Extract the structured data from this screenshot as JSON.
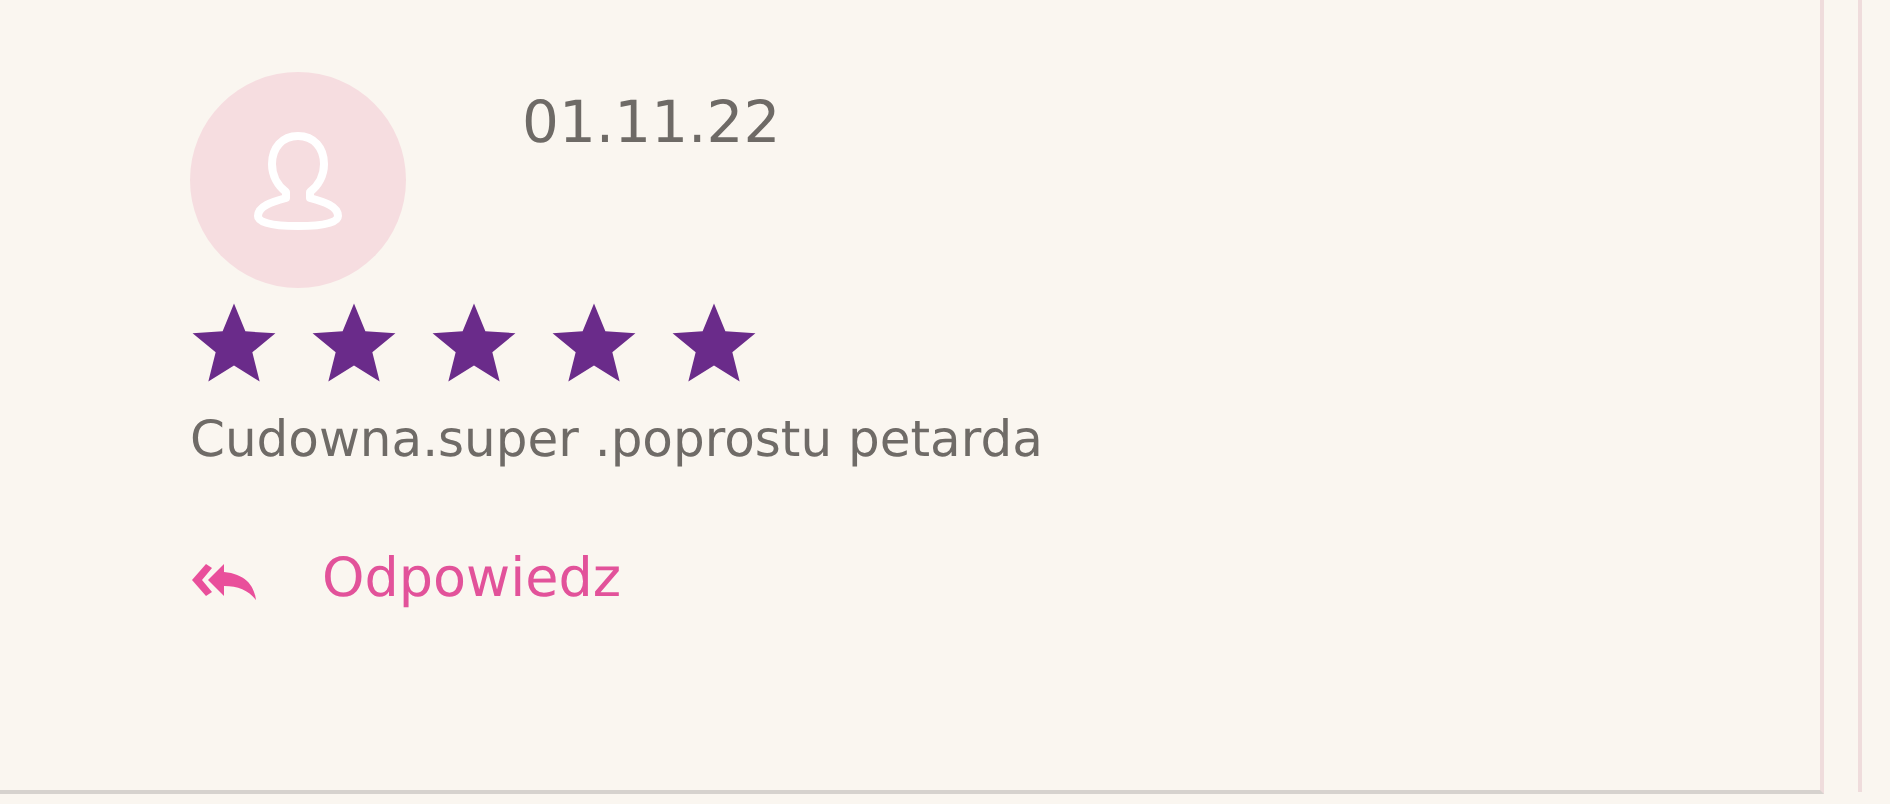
{
  "review": {
    "date": "01.11.22",
    "stars": 5,
    "text": "Cudowna.super .poprostu petarda",
    "reply_label": "Odpowiedz"
  }
}
